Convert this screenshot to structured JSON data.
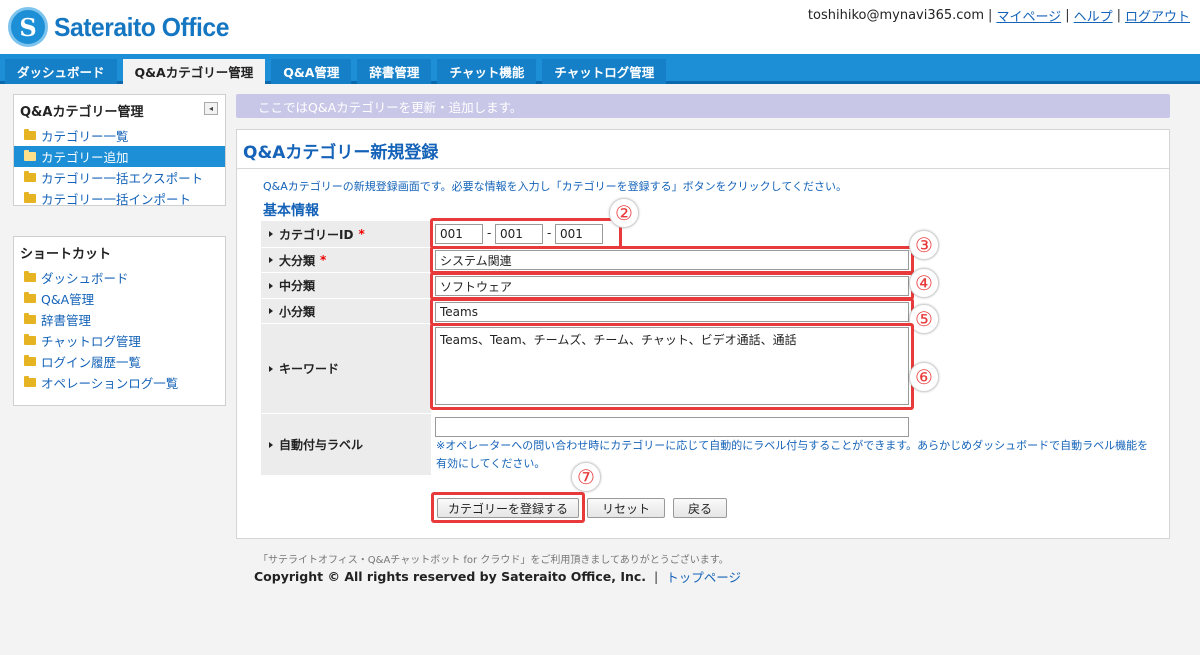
{
  "header": {
    "logo_mark": "S",
    "logo_text": "Sateraito Office",
    "user_email": "toshihiko@mynavi365.com",
    "links": [
      "マイページ",
      "ヘルプ",
      "ログアウト"
    ]
  },
  "nav": {
    "tabs": [
      {
        "label": "ダッシュボード"
      },
      {
        "label": "Q&Aカテゴリー管理",
        "active": true
      },
      {
        "label": "Q&A管理"
      },
      {
        "label": "辞書管理"
      },
      {
        "label": "チャット機能"
      },
      {
        "label": "チャットログ管理"
      }
    ]
  },
  "sidebar": {
    "panel1": {
      "title": "Q&Aカテゴリー管理",
      "collapse_icon": "◂",
      "items": [
        {
          "label": "カテゴリー一覧"
        },
        {
          "label": "カテゴリー追加",
          "active": true
        },
        {
          "label": "カテゴリー一括エクスポート"
        },
        {
          "label": "カテゴリー一括インポート"
        }
      ]
    },
    "panel2": {
      "title": "ショートカット",
      "items": [
        {
          "label": "ダッシュボード"
        },
        {
          "label": "Q&A管理"
        },
        {
          "label": "辞書管理"
        },
        {
          "label": "チャットログ管理"
        },
        {
          "label": "ログイン履歴一覧"
        },
        {
          "label": "オペレーションログ一覧"
        }
      ]
    }
  },
  "info_bar": "ここではQ&Aカテゴリーを更新・追加します。",
  "form": {
    "title": "Q&Aカテゴリー新規登録",
    "description": "Q&Aカテゴリーの新規登録画面です。必要な情報を入力し「カテゴリーを登録する」ボタンをクリックしてください。",
    "section": "基本情報",
    "required_mark": "*",
    "fields": {
      "category_id": {
        "label": "カテゴリーID",
        "values": [
          "001",
          "001",
          "001"
        ],
        "separator": "-"
      },
      "major": {
        "label": "大分類",
        "value": "システム関連"
      },
      "middle": {
        "label": "中分類",
        "value": "ソフトウェア"
      },
      "minor": {
        "label": "小分類",
        "value": "Teams"
      },
      "keyword": {
        "label": "キーワード",
        "value": "Teams、Team、チームズ、チーム、チャット、ビデオ通話、通話"
      },
      "auto_label": {
        "label": "自動付与ラベル",
        "value": "",
        "note": "※オペレーターへの問い合わせ時にカテゴリーに応じて自動的にラベル付与することができます。あらかじめダッシュボードで自動ラベル機能を有効にしてください。"
      }
    },
    "buttons": {
      "register": "カテゴリーを登録する",
      "reset": "リセット",
      "back": "戻る"
    }
  },
  "annotations": {
    "badges": [
      "②",
      "③",
      "④",
      "⑤",
      "⑥",
      "⑦"
    ],
    "highlight_color": "#e83a3a"
  },
  "footer": {
    "thanks": "「サテライトオフィス・Q&Aチャットボット for クラウド」をご利用頂きましてありがとうございます。",
    "copyright": "Copyright © All rights reserved by Sateraito Office, Inc.",
    "top_link": "トップページ"
  },
  "colors": {
    "accent": "#1d8fd6",
    "link": "#1563b8",
    "info_bar": "#c8c7e8"
  }
}
